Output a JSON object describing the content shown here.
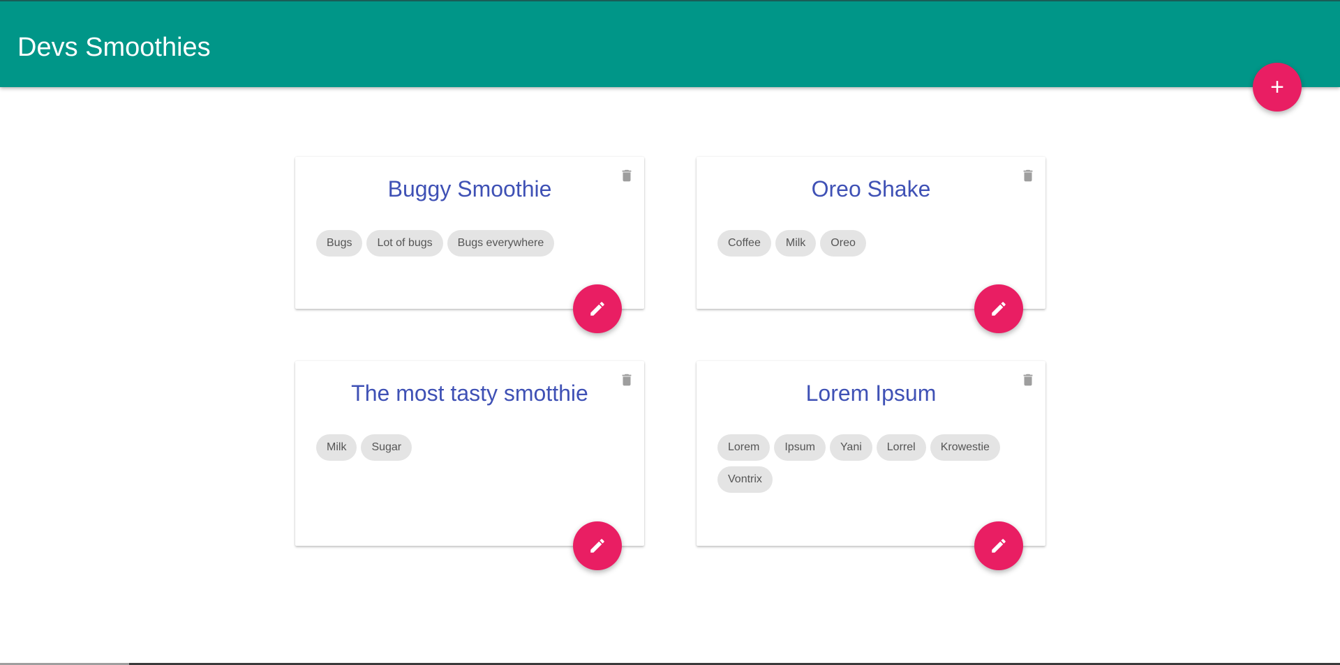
{
  "appbar": {
    "title": "Devs Smoothies",
    "color": "#009688"
  },
  "actions": {
    "add_icon": "plus-icon",
    "edit_icon": "pencil-icon",
    "delete_icon": "trash-icon",
    "accent_color": "#e91e63"
  },
  "smoothies": [
    {
      "title": "Buggy Smoothie",
      "ingredients": [
        "Bugs",
        "Lot of bugs",
        "Bugs everywhere"
      ]
    },
    {
      "title": "Oreo Shake",
      "ingredients": [
        "Coffee",
        "Milk",
        "Oreo"
      ]
    },
    {
      "title": "The most tasty smotthie",
      "ingredients": [
        "Milk",
        "Sugar"
      ]
    },
    {
      "title": "Lorem Ipsum",
      "ingredients": [
        "Lorem",
        "Ipsum",
        "Yani",
        "Lorrel",
        "Krowestie",
        "Vontrix"
      ]
    }
  ]
}
